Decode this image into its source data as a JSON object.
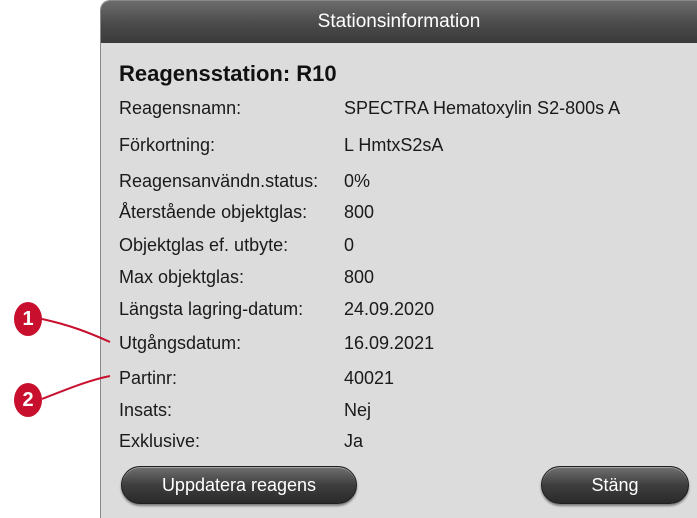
{
  "dialog": {
    "title": "Stationsinformation",
    "heading": "Reagensstation: R10",
    "rows": [
      {
        "label": "Reagensnamn:",
        "value": "SPECTRA Hematoxylin S2-800s A"
      },
      {
        "label": "Förkortning:",
        "value": "L HmtxS2sA"
      },
      {
        "label": "Reagensanvändn.status:",
        "value": "0%"
      },
      {
        "label": "Återstående objektglas:",
        "value": "800"
      },
      {
        "label": "Objektglas ef. utbyte:",
        "value": "0"
      },
      {
        "label": "Max objektglas:",
        "value": "800"
      },
      {
        "label": "Längsta lagring-datum:",
        "value": "24.09.2020"
      },
      {
        "label": "Utgångsdatum:",
        "value": "16.09.2021"
      },
      {
        "label": "Partinr:",
        "value": "40021"
      },
      {
        "label": "Insats:",
        "value": "Nej"
      },
      {
        "label": "Exklusive:",
        "value": "Ja"
      }
    ],
    "buttons": {
      "update_label": "Uppdatera reagens",
      "close_label": "Stäng"
    }
  },
  "callouts": [
    {
      "number": "1",
      "color": "#c8102e"
    },
    {
      "number": "2",
      "color": "#c8102e"
    }
  ]
}
